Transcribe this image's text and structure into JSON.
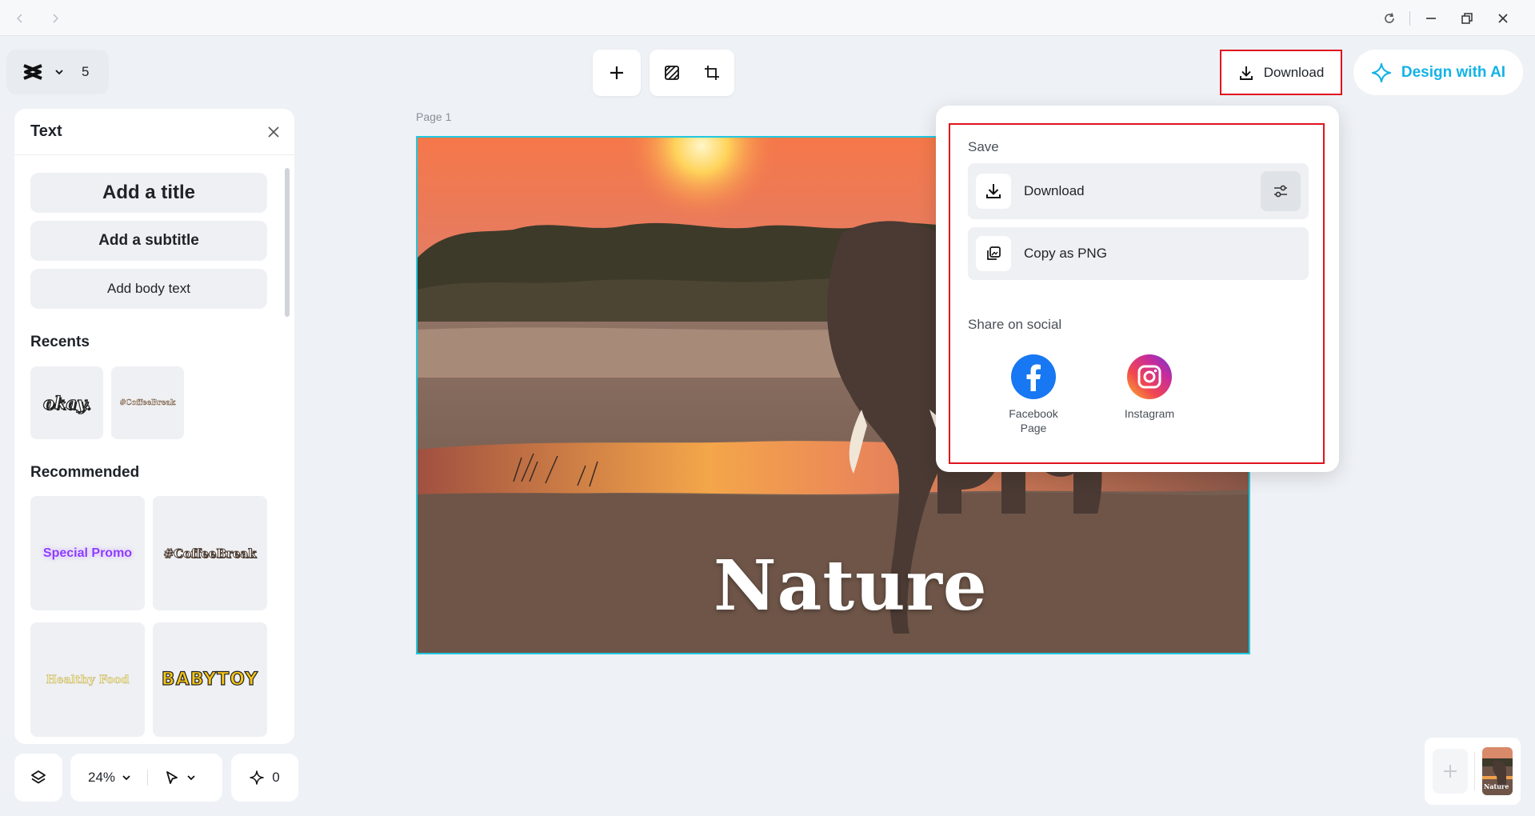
{
  "toolbar": {
    "page_count": "5",
    "download_label": "Download",
    "design_ai_label": "Design with AI"
  },
  "text_panel": {
    "title": "Text",
    "add_title": "Add a title",
    "add_subtitle": "Add a subtitle",
    "add_body": "Add body text",
    "recents_label": "Recents",
    "recents": [
      "okay.",
      "#CoffeeBreak"
    ],
    "recommended_label": "Recommended",
    "recommended": [
      "Special Promo",
      "#CoffeeBreak",
      "Healthy Food",
      "BABYTOY"
    ]
  },
  "canvas": {
    "page_label": "Page 1",
    "title_text": "Nature"
  },
  "bottom_bar": {
    "zoom": "24%",
    "ai_count": "0"
  },
  "dropdown": {
    "save_label": "Save",
    "download_label": "Download",
    "copy_png_label": "Copy as PNG",
    "share_label": "Share on social",
    "facebook_label": "Facebook Page",
    "instagram_label": "Instagram"
  },
  "thumbnail": {
    "text": "Nature"
  },
  "colors": {
    "accent": "#13b3e6",
    "highlight_border": "#e0141e",
    "canvas_border": "#20c9e0",
    "facebook": "#1877f2"
  },
  "icons": {
    "back": "chevron-left-icon",
    "forward": "chevron-right-icon",
    "refresh": "refresh-icon",
    "minimize": "minimize-icon",
    "restore": "restore-icon",
    "close": "close-icon",
    "download": "download-icon",
    "settings": "sliders-icon",
    "copy": "copy-icon",
    "ai": "ai-sparkle-icon"
  }
}
